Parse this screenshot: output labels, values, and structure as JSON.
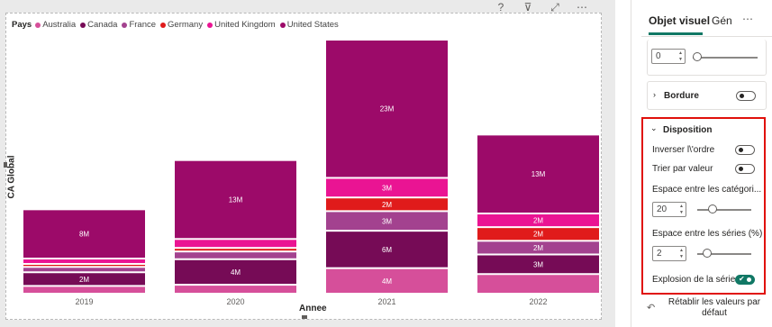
{
  "visual_header": {
    "help_icon": "?",
    "filter_icon": "⊽",
    "focus_icon": "⤢",
    "more_icon": "⋯"
  },
  "legend": {
    "title": "Pays",
    "items": [
      {
        "name": "Australia",
        "color": "#d64f9a"
      },
      {
        "name": "Canada",
        "color": "#760b56"
      },
      {
        "name": "France",
        "color": "#a3428f"
      },
      {
        "name": "Germany",
        "color": "#e01b1b"
      },
      {
        "name": "United Kingdom",
        "color": "#ea1493"
      },
      {
        "name": "United States",
        "color": "#9c0a69"
      }
    ]
  },
  "chart_data": {
    "type": "bar",
    "stacked": true,
    "title": "",
    "xlabel": "Annee",
    "ylabel": "CA Global",
    "categories": [
      "2019",
      "2020",
      "2021",
      "2022"
    ],
    "series": [
      {
        "name": "Australia",
        "color": "#d64f9a",
        "values": [
          1,
          1.2,
          4,
          3
        ],
        "labels": [
          "",
          "",
          "4M",
          ""
        ]
      },
      {
        "name": "Canada",
        "color": "#760b56",
        "values": [
          2,
          4,
          6,
          3
        ],
        "labels": [
          "2M",
          "4M",
          "6M",
          "3M"
        ]
      },
      {
        "name": "France",
        "color": "#a3428f",
        "values": [
          0.6,
          1,
          3,
          2
        ],
        "labels": [
          "",
          "",
          "3M",
          "2M"
        ]
      },
      {
        "name": "Germany",
        "color": "#e01b1b",
        "values": [
          0.2,
          0.3,
          2,
          2
        ],
        "labels": [
          "",
          "",
          "2M",
          "2M"
        ]
      },
      {
        "name": "United Kingdom",
        "color": "#ea1493",
        "values": [
          0.6,
          1.2,
          3,
          2
        ],
        "labels": [
          "",
          "",
          "3M",
          "2M"
        ]
      },
      {
        "name": "United States",
        "color": "#9c0a69",
        "values": [
          8,
          13,
          23,
          13
        ],
        "labels": [
          "8M",
          "13M",
          "23M",
          "13M"
        ]
      }
    ],
    "legend_position": "top-left",
    "grid": false
  },
  "pane": {
    "tab_active": "Objet visuel",
    "tab_other": "Gén",
    "tab_more": "⋯",
    "top_spin_value": "0",
    "bordure": {
      "title": "Bordure"
    },
    "disposition": {
      "title": "Disposition",
      "inverser_label": "Inverser l\\'ordre",
      "trier_label": "Trier par valeur",
      "espace_categories_label": "Espace entre les catégori...",
      "espace_categories_value": "20",
      "espace_series_label": "Espace entre les séries (%)",
      "espace_series_value": "2",
      "explosion_label": "Explosion de la série"
    },
    "reset_label": "Rétablir les valeurs par défaut",
    "reset_icon": "↶"
  }
}
